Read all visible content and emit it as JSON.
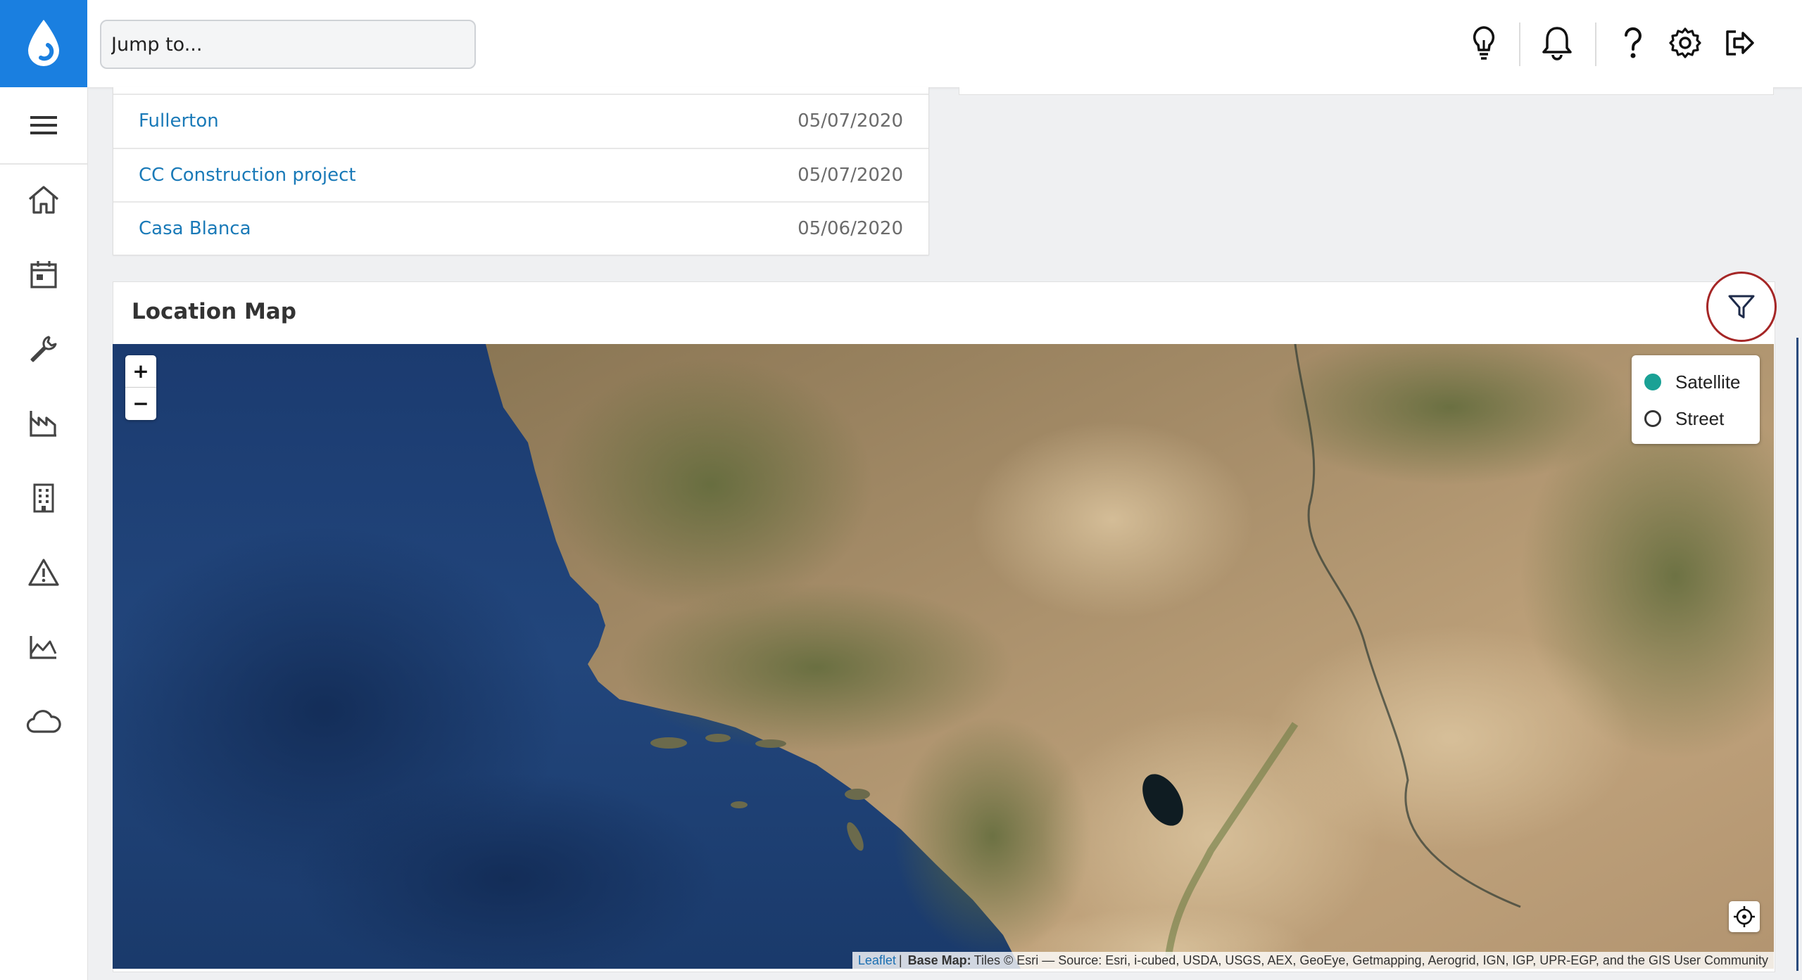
{
  "header": {
    "search_placeholder": "Jump to...",
    "icons": [
      "lightbulb-icon",
      "bell-icon",
      "help-icon",
      "settings-icon",
      "logout-icon"
    ]
  },
  "sidebar": {
    "items": [
      "menu-icon",
      "home-icon",
      "calendar-icon",
      "wrench-icon",
      "factory-icon",
      "building-icon",
      "warning-icon",
      "chart-icon",
      "cloud-icon"
    ]
  },
  "projects": [
    {
      "name": "Fullerton",
      "date": "05/07/2020"
    },
    {
      "name": "CC Construction project",
      "date": "05/07/2020"
    },
    {
      "name": "Casa Blanca",
      "date": "05/06/2020"
    }
  ],
  "map": {
    "title": "Location Map",
    "zoom_in": "+",
    "zoom_out": "−",
    "layers": [
      {
        "label": "Satellite",
        "selected": true
      },
      {
        "label": "Street",
        "selected": false
      }
    ],
    "attribution": {
      "link": "Leaflet",
      "separator": "|",
      "basemap_label": "Base Map:",
      "text": "Tiles © Esri — Source: Esri, i-cubed, USDA, USGS, AEX, GeoEye, Getmapping, Aerogrid, IGN, IGP, UPR-EGP, and the GIS User Community"
    }
  },
  "colors": {
    "brand": "#1a7fe0",
    "link": "#1a7ab8",
    "radio_selected": "#1aa195",
    "highlight_ring": "#a52626"
  }
}
